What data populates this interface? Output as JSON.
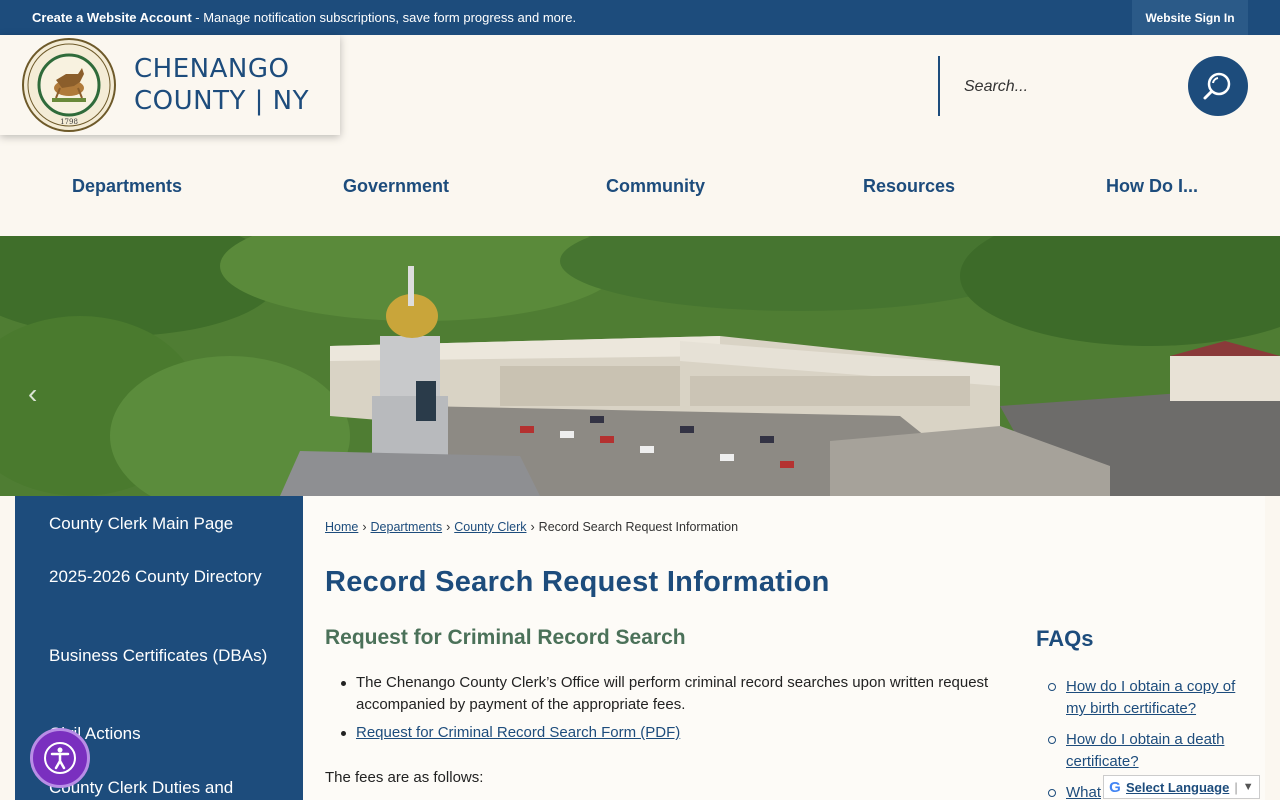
{
  "topbar": {
    "account_link": "Create a Website Account",
    "message": " - Manage notification subscriptions, save form progress and more.",
    "signin_label": "Website Sign In"
  },
  "header": {
    "logo_line1": "CHENANGO",
    "logo_line2": "COUNTY",
    "logo_sep": "|",
    "logo_state": "NY",
    "seal_text": "SEAL OF CHENANGO COUNTY N.Y.",
    "seal_year": "1798",
    "search_placeholder": "Search..."
  },
  "nav": {
    "items": [
      "Departments",
      "Government",
      "Community",
      "Resources",
      "How Do I..."
    ]
  },
  "hero": {
    "prev_label": "‹"
  },
  "sidebar": {
    "items": [
      "County Clerk Main Page",
      "2025-2026 County Directory",
      "Business Certificates (DBAs)",
      "Civil Actions",
      "County Clerk Duties and"
    ]
  },
  "breadcrumb": {
    "items": [
      "Home",
      "Departments",
      "County Clerk"
    ],
    "current": "Record Search Request Information",
    "sep": "›"
  },
  "main": {
    "title": "Record Search Request Information",
    "subtitle": "Request for Criminal Record Search",
    "bullet1": "The Chenango County Clerk’s Office will perform criminal record searches upon written request accompanied by payment of the appropriate fees.",
    "bullet2_link": "Request for Criminal Record Search Form (PDF)",
    "fees_text": "The fees are as follows:"
  },
  "faqs": {
    "title": "FAQs",
    "items": [
      "How do I obtain a copy of my birth certificate?",
      "How do I obtain a death certificate?",
      "What"
    ]
  },
  "translate": {
    "label": "Select Language",
    "sep": "|",
    "arrow": "▼",
    "google_glyph": "G"
  },
  "colors": {
    "brand": "#1d4c7c",
    "subheading": "#4b7159",
    "accessibility": "#7a2fbf"
  },
  "icons": {
    "search": "search-icon",
    "accessibility": "accessibility-icon",
    "seal": "county-seal"
  }
}
